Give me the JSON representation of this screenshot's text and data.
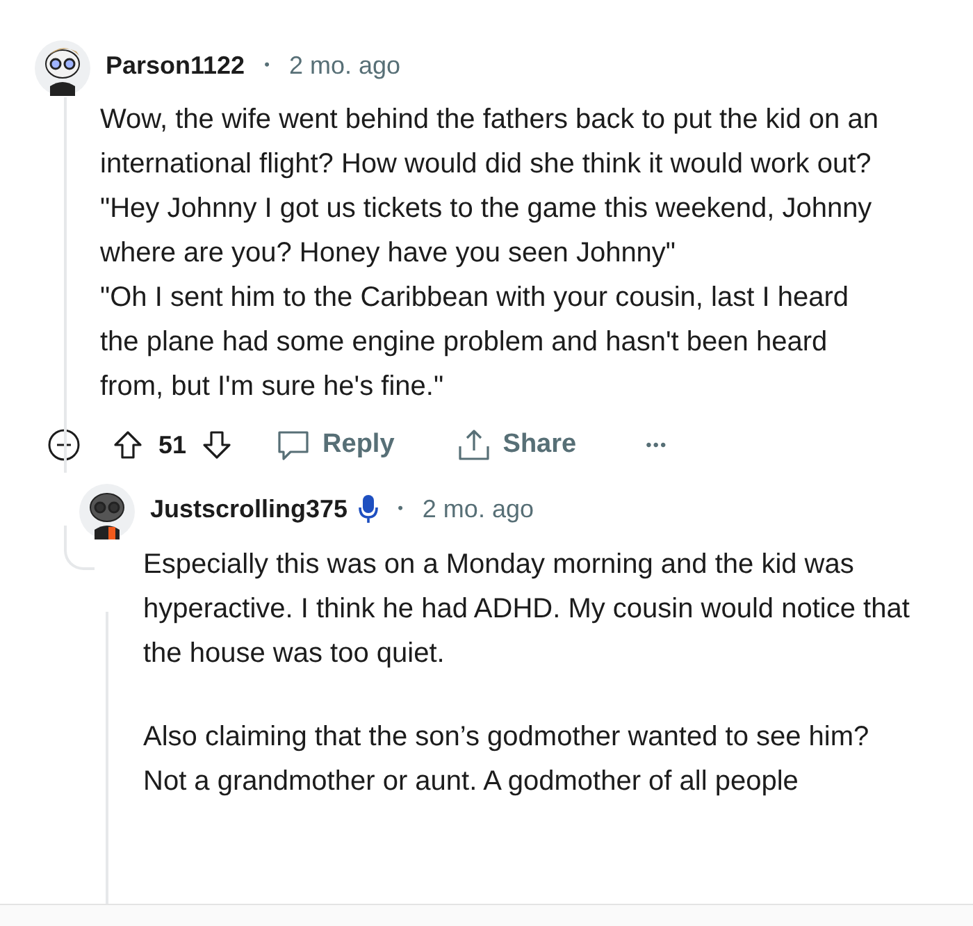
{
  "comment": {
    "author": "Parson1122",
    "separator": "•",
    "time": "2 mo. ago",
    "paragraphs": [
      "Wow, the wife went behind the fathers back to put the kid on an international flight? How would did she think it would work out?",
      "\"Hey Johnny I got us tickets to the game this weekend, Johnny where are you? Honey have you seen Johnny\"",
      "\"Oh I sent him to the Caribbean with your cousin, last I heard the plane had some engine problem and hasn't been heard from, but I'm sure he's fine.\""
    ],
    "actions": {
      "score": "51",
      "reply": "Reply",
      "share": "Share",
      "more": "•••"
    }
  },
  "reply": {
    "author": "Justscrolling375",
    "voice_badge": true,
    "separator": "•",
    "time": "2 mo. ago",
    "paragraphs": [
      "Especially this was on a Monday morning and the kid was hyperactive. I think he had ADHD. My cousin would notice that the house was too quiet.",
      "Also claiming that the son’s godmother wanted to see him? Not a grandmother or aunt. A godmother of all people"
    ]
  }
}
